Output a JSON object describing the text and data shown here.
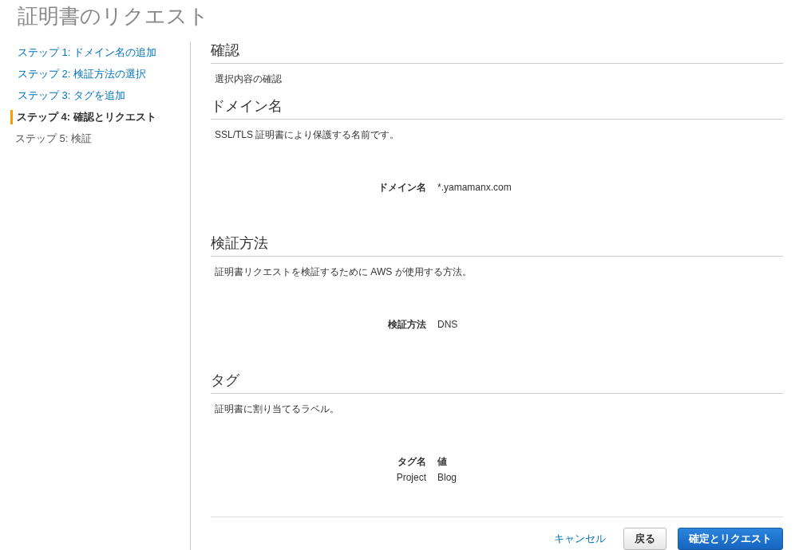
{
  "page_title": "証明書のリクエスト",
  "steps": [
    {
      "label": "ステップ 1: ドメイン名の追加",
      "selected": false,
      "completed": true
    },
    {
      "label": "ステップ 2: 検証方法の選択",
      "selected": false,
      "completed": true
    },
    {
      "label": "ステップ 3: タグを追加",
      "selected": false,
      "completed": true
    },
    {
      "label": "ステップ 4: 確認とリクエスト",
      "selected": true,
      "completed": false
    },
    {
      "label": "ステップ 5: 検証",
      "selected": false,
      "completed": false
    }
  ],
  "sections": [
    {
      "kind": "intro",
      "heading": "確認",
      "description": "選択内容の確認"
    },
    {
      "kind": "fields",
      "heading": "ドメイン名",
      "description": "SSL/TLS 証明書により保護する名前です。",
      "fields": [
        {
          "label": "ドメイン名",
          "value": "*.yamamanx.com"
        }
      ]
    },
    {
      "kind": "fields",
      "heading": "検証方法",
      "description": "証明書リクエストを検証するために AWS が使用する方法。",
      "fields": [
        {
          "label": "検証方法",
          "value": "DNS"
        }
      ]
    },
    {
      "kind": "table",
      "heading": "タグ",
      "description": "証明書に割り当てるラベル。",
      "columns": [
        "タグ名",
        "値"
      ],
      "rows": [
        [
          "Project",
          "Blog"
        ]
      ]
    }
  ],
  "footer": {
    "cancel": "キャンセル",
    "back": "戻る",
    "submit": "確定とリクエスト"
  }
}
